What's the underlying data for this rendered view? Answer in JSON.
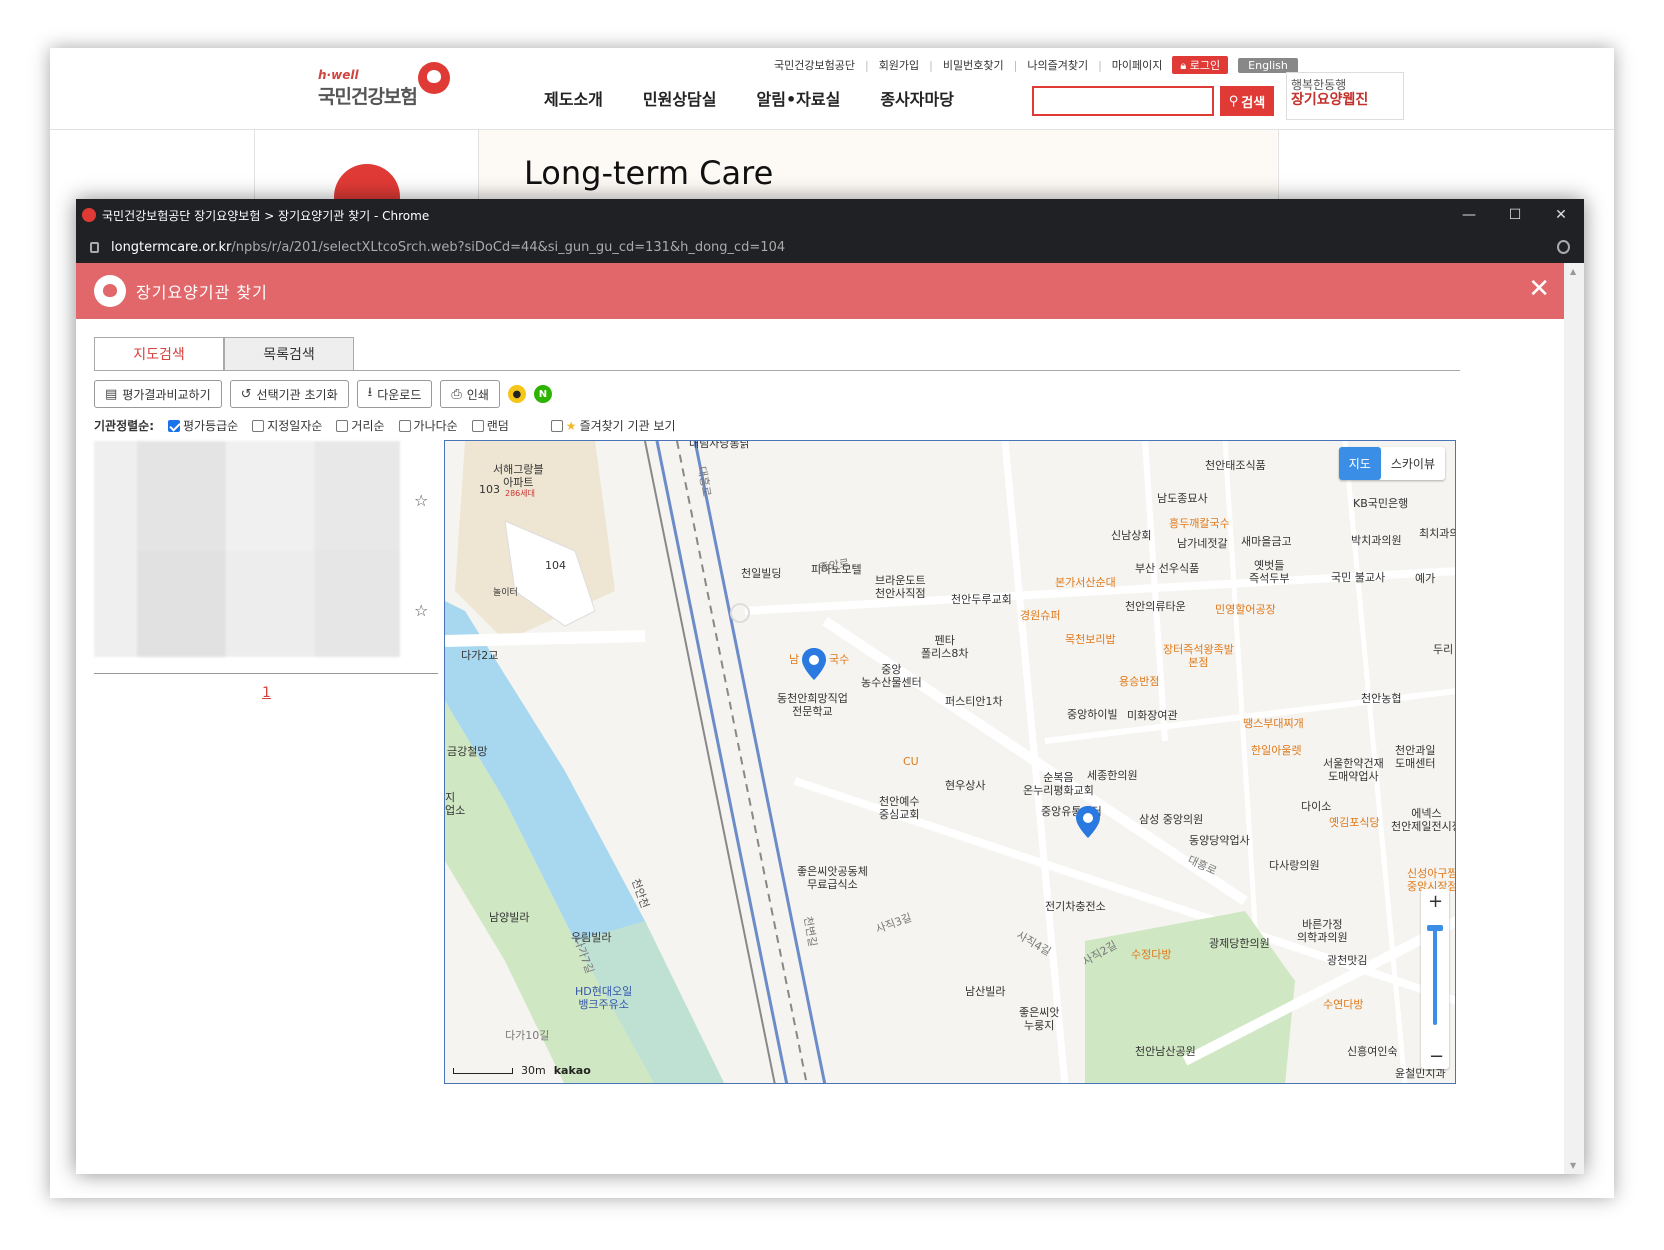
{
  "site": {
    "logo_small": "h·well",
    "logo_text": "국민건강보험",
    "util_links": [
      "국민건강보험공단",
      "회원가입",
      "비밀번호찾기",
      "나의즐겨찾기",
      "마이페이지"
    ],
    "login_label": "로그인",
    "english_label": "English",
    "gnb": [
      "제도소개",
      "민원상담실",
      "알림•자료실",
      "종사자마당"
    ],
    "search_value": "",
    "search_button": "검색",
    "banner_line1": "행복한동행",
    "banner_line2": "장기요양웹진",
    "hero_title": "Long-term Care",
    "brand_color": "#e03a36"
  },
  "window": {
    "title": "국민건강보험공단 장기요양보험 > 장기요양기관 찾기 - Chrome",
    "url_host": "longtermcare.or.kr",
    "url_path": "/npbs/r/a/201/selectXLtcoSrch.web?siDoCd=44&si_gun_gu_cd=131&h_dong_cd=104",
    "minimize": "—",
    "maximize": "☐",
    "close": "✕"
  },
  "modal": {
    "title": "장기요양기관 찾기",
    "close": "✕",
    "tabs": [
      "지도검색",
      "목록검색"
    ],
    "toolbar": {
      "compare": "평가결과비교하기",
      "reset": "선택기관 초기화",
      "download": "다운로드",
      "print": "인쇄"
    },
    "sort_label": "기관정렬순:",
    "sort_options": [
      {
        "label": "평가등급순",
        "checked": true
      },
      {
        "label": "지정일자순",
        "checked": false
      },
      {
        "label": "거리순",
        "checked": false
      },
      {
        "label": "가나다순",
        "checked": false
      },
      {
        "label": "랜덤",
        "checked": false
      }
    ],
    "favorites_label": "즐겨찾기 기관 보기",
    "page_number": "1"
  },
  "map": {
    "type_map": "지도",
    "type_sky": "스카이뷰",
    "zoom_in": "+",
    "zoom_out": "−",
    "scale_text": "30m",
    "brand": "kakao",
    "labels": {
      "l1": "서해그랑블\n아파트",
      "l2": "103",
      "l3": "286세대",
      "l4": "104",
      "l5": "놀이터",
      "l6": "다가2교",
      "l7": "천일빌딩",
      "l8": "피아노모텔",
      "l9": "브라운도트\n천안사직점",
      "l10": "천안두루교회",
      "l11": "본가서산순대",
      "l12": "경원슈퍼",
      "l13": "목천보리밥",
      "l14": "천안태조식품",
      "l15": "남도종묘사",
      "l16": "흥두깨칼국수",
      "l17": "신남상회",
      "l18": "남가네젓갈",
      "l19": "새마을금고",
      "l20": "KB국민은행",
      "l21": "박치과의원",
      "l22": "부산 선우식품",
      "l23": "옛벗들\n즉석두부",
      "l24": "국민 불교사",
      "l25": "천안의류타운",
      "l26": "민영할어공장",
      "l27": "장터즉석왕족발\n본점",
      "l28": "용승반점",
      "l29": "미화장여관",
      "l30": "중앙하이빌",
      "l31": "동천안희망직업\n전문학교",
      "l32": "중앙\n농수산물센터",
      "l33": "펜타\n폴리스8차",
      "l34": "퍼스티안1차",
      "l35": "CU",
      "l36": "현우상사",
      "l37": "천안예수\n중심교회",
      "l38": "순복음\n온누리평화교회",
      "l39": "세종한의원",
      "l40": "중앙유통센터",
      "l41": "삼성 중앙의원",
      "l42": "동양당약업사",
      "l43": "땡스부대찌개",
      "l44": "한일아울렛",
      "l45": "서울한약건재\n도매약업사",
      "l46": "천안과일\n도매센터",
      "l47": "다이소",
      "l48": "옛김포식당",
      "l49": "에넥스\n천안제일전시장",
      "l50": "다사랑의원",
      "l51": "신성아구찜\n중앙시장점",
      "l52": "천안농협",
      "l53": "금강철망",
      "l54": "좋은씨앗공동체\n무료급식소",
      "l55": "전기차충전소",
      "l56": "남양빌라",
      "l57": "우림빌라",
      "l58": "HD현대오일\n뱅크주유소",
      "l59": "남산빌라",
      "l60": "좋은씨앗\n누룽지",
      "l61": "수정다방",
      "l62": "광제당한의원",
      "l63": "바른가정\n의학과의원",
      "l64": "광천맛김",
      "l65": "수연다방",
      "l66": "천안남산공원",
      "l67": "신흥여인숙",
      "l68": "윤철민치과",
      "l69": "대흥로",
      "l70": "사직3길",
      "l71": "사직4길",
      "l72": "사직2길",
      "l73": "대흥로",
      "l74": "천안천",
      "l75": "다가10길",
      "l76": "다가7길",
      "l77": "중앙로",
      "l78": "천변길",
      "l79": "최치과의",
      "l80": "예가",
      "l81": "두리",
      "l82": "남",
      "l83": "국수",
      "l84": "지\n업소",
      "l85": "대림사당통닭"
    }
  }
}
